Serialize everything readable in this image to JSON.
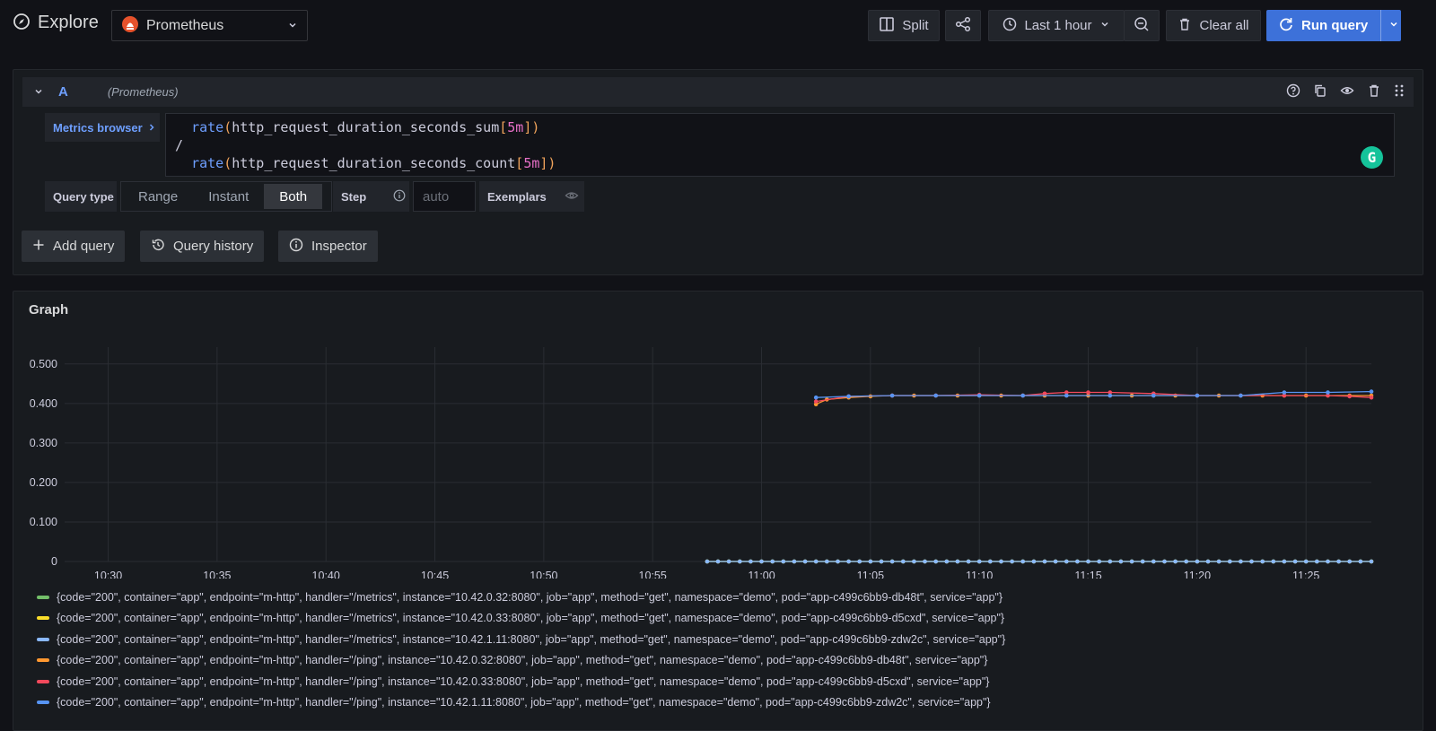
{
  "header": {
    "title": "Explore",
    "datasource": "Prometheus",
    "split_label": "Split",
    "time_range_label": "Last 1 hour",
    "clear_all_label": "Clear all",
    "run_query_label": "Run query"
  },
  "query": {
    "ref_id": "A",
    "datasource": "(Prometheus)",
    "metrics_browser_label": "Metrics browser",
    "expression": {
      "line1_fn": "rate",
      "line1_metric": "http_request_duration_seconds_sum",
      "line1_range": "5m",
      "line2": "/",
      "line3_fn": "rate",
      "line3_metric": "http_request_duration_seconds_count",
      "line3_range": "5m"
    },
    "query_type_label": "Query type",
    "query_types": [
      "Range",
      "Instant",
      "Both"
    ],
    "query_type_selected": "Both",
    "step_label": "Step",
    "step_placeholder": "auto",
    "exemplars_label": "Exemplars"
  },
  "actions": {
    "add_query": "Add query",
    "query_history": "Query history",
    "inspector": "Inspector"
  },
  "graph": {
    "title": "Graph"
  },
  "chart_data": {
    "type": "line",
    "title": "Graph",
    "xlabel": "",
    "ylabel": "",
    "x_ticks": [
      "10:30",
      "10:35",
      "10:40",
      "10:45",
      "10:50",
      "10:55",
      "11:00",
      "11:05",
      "11:10",
      "11:15",
      "11:20",
      "11:25"
    ],
    "y_ticks": [
      "0",
      "0.100",
      "0.200",
      "0.300",
      "0.400",
      "0.500"
    ],
    "xlim": [
      "10:28",
      "11:28"
    ],
    "ylim": [
      0,
      0.52
    ],
    "grid": true,
    "legend_placement": "bottom",
    "series": [
      {
        "name": "{code=\"200\", container=\"app\", endpoint=\"m-http\", handler=\"/metrics\", instance=\"10.42.0.32:8080\", job=\"app\", method=\"get\", namespace=\"demo\", pod=\"app-c499c6bb9-db48t\", service=\"app\"}",
        "color": "#73bf69",
        "x": [
          "10:57:30",
          "11:28:00"
        ],
        "y": [
          0.0,
          0.0
        ],
        "note_values": "constant ~0"
      },
      {
        "name": "{code=\"200\", container=\"app\", endpoint=\"m-http\", handler=\"/metrics\", instance=\"10.42.0.33:8080\", job=\"app\", method=\"get\", namespace=\"demo\", pod=\"app-c499c6bb9-d5cxd\", service=\"app\"}",
        "color": "#fade2a",
        "x": [
          "10:57:30",
          "11:28:00"
        ],
        "y": [
          0.0,
          0.0
        ]
      },
      {
        "name": "{code=\"200\", container=\"app\", endpoint=\"m-http\", handler=\"/metrics\", instance=\"10.42.1.11:8080\", job=\"app\", method=\"get\", namespace=\"demo\", pod=\"app-c499c6bb9-zdw2c\", service=\"app\"}",
        "color": "#8ab8ff",
        "x": [
          "10:57:30",
          "11:28:00"
        ],
        "y": [
          0.0,
          0.0
        ]
      },
      {
        "name": "{code=\"200\", container=\"app\", endpoint=\"m-http\", handler=\"/ping\", instance=\"10.42.0.32:8080\", job=\"app\", method=\"get\", namespace=\"demo\", pod=\"app-c499c6bb9-db48t\", service=\"app\"}",
        "color": "#ff9830",
        "x": [
          "11:02:30",
          "11:03:00",
          "11:04:00",
          "11:05:00",
          "11:06:00",
          "11:07:00",
          "11:08:00",
          "11:09:00",
          "11:10:00",
          "11:11:00",
          "11:12:00",
          "11:13:00",
          "11:14:00",
          "11:15:00",
          "11:16:00",
          "11:17:00",
          "11:18:00",
          "11:19:00",
          "11:20:00",
          "11:21:00",
          "11:22:00",
          "11:23:00",
          "11:24:00",
          "11:25:00",
          "11:26:00",
          "11:27:00",
          "11:28:00"
        ],
        "y": [
          0.398,
          0.41,
          0.415,
          0.418,
          0.42,
          0.42,
          0.42,
          0.42,
          0.42,
          0.42,
          0.42,
          0.42,
          0.42,
          0.42,
          0.42,
          0.42,
          0.42,
          0.42,
          0.42,
          0.42,
          0.42,
          0.42,
          0.42,
          0.42,
          0.42,
          0.42,
          0.42
        ]
      },
      {
        "name": "{code=\"200\", container=\"app\", endpoint=\"m-http\", handler=\"/ping\", instance=\"10.42.0.33:8080\", job=\"app\", method=\"get\", namespace=\"demo\", pod=\"app-c499c6bb9-d5cxd\", service=\"app\"}",
        "color": "#f2495c",
        "x": [
          "11:02:30",
          "11:04:00",
          "11:06:00",
          "11:08:00",
          "11:10:00",
          "11:12:00",
          "11:13:00",
          "11:14:00",
          "11:15:00",
          "11:16:00",
          "11:18:00",
          "11:20:00",
          "11:22:00",
          "11:24:00",
          "11:26:00",
          "11:27:00",
          "11:28:00"
        ],
        "y": [
          0.405,
          0.418,
          0.42,
          0.42,
          0.422,
          0.42,
          0.425,
          0.428,
          0.428,
          0.428,
          0.425,
          0.42,
          0.42,
          0.42,
          0.42,
          0.418,
          0.415
        ]
      },
      {
        "name": "{code=\"200\", container=\"app\", endpoint=\"m-http\", handler=\"/ping\", instance=\"10.42.1.11:8080\", job=\"app\", method=\"get\", namespace=\"demo\", pod=\"app-c499c6bb9-zdw2c\", service=\"app\"}",
        "color": "#5794f2",
        "x": [
          "11:02:30",
          "11:04:00",
          "11:06:00",
          "11:08:00",
          "11:10:00",
          "11:12:00",
          "11:14:00",
          "11:16:00",
          "11:18:00",
          "11:20:00",
          "11:22:00",
          "11:24:00",
          "11:26:00",
          "11:28:00"
        ],
        "y": [
          0.415,
          0.418,
          0.42,
          0.42,
          0.42,
          0.42,
          0.42,
          0.42,
          0.42,
          0.42,
          0.42,
          0.428,
          0.428,
          0.43
        ]
      }
    ]
  },
  "colors": {
    "accent": "#3d71d9",
    "link": "#6e9fff"
  }
}
